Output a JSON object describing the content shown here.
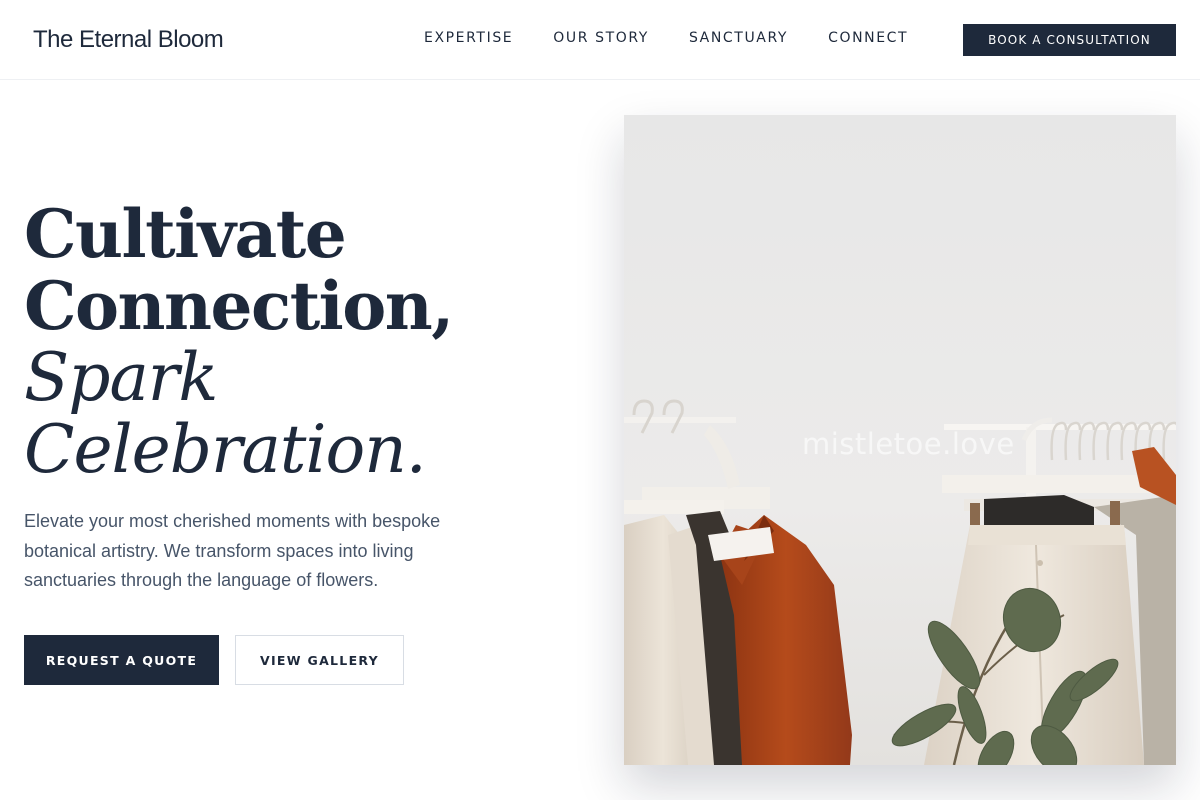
{
  "header": {
    "brand": "The Eternal Bloom",
    "nav": [
      "EXPERTISE",
      "OUR STORY",
      "SANCTUARY",
      "CONNECT"
    ],
    "cta": "BOOK A CONSULTATION"
  },
  "hero": {
    "headline_line1": "Cultivate",
    "headline_line2": "Connection,",
    "headline_line3": "Spark",
    "headline_line4": "Celebration.",
    "description": "Elevate your most cherished moments with bespoke botanical artistry. We transform spaces into living sanctuaries through the language of flowers.",
    "primary_button": "REQUEST A QUOTE",
    "secondary_button": "VIEW GALLERY",
    "image_watermark": "mistletoe.love"
  },
  "colors": {
    "ink": "#1e293b",
    "body_text": "#475569",
    "rust_garment": "#b24a1c",
    "plant_leaf": "#5f6b4f"
  },
  "icons": {
    "clothing_rack_photo": "photo"
  }
}
